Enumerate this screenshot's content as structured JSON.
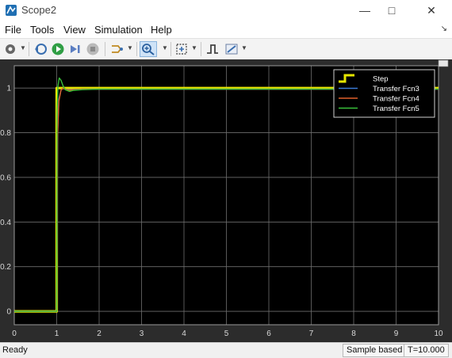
{
  "window": {
    "title": "Scope2"
  },
  "menu": [
    "File",
    "Tools",
    "View",
    "Simulation",
    "Help"
  ],
  "status": {
    "left": "Ready",
    "mode": "Sample based",
    "time": "T=10.000"
  },
  "colors": {
    "plot_bg": "#000000",
    "frame_bg": "#2c2c2c",
    "grid": "#6e6e6e",
    "axis_text": "#d9d9d9",
    "step": "#e6e600",
    "fcn3": "#3a7bd5",
    "fcn4": "#e0602a",
    "fcn5": "#39c13a"
  },
  "chart_data": {
    "type": "line",
    "title": "",
    "xlabel": "",
    "ylabel": "",
    "xlim": [
      0,
      10
    ],
    "ylim": [
      -0.06,
      1.1
    ],
    "xticks": [
      "0",
      "1",
      "2",
      "3",
      "4",
      "5",
      "6",
      "7",
      "8",
      "9",
      "10"
    ],
    "yticks": [
      {
        "v": 0,
        "label": "0"
      },
      {
        "v": 0.2,
        "label": "0.2"
      },
      {
        "v": 0.4,
        "label": "0.4"
      },
      {
        "v": 0.6,
        "label": "0.6"
      },
      {
        "v": 0.8,
        "label": "0.8"
      },
      {
        "v": 1,
        "label": "1"
      }
    ],
    "grid": true,
    "legend_position": "top-right",
    "series": [
      {
        "name": "Step",
        "color": "#e6e600",
        "x": [
          0,
          1,
          1,
          10
        ],
        "y": [
          0,
          0,
          1,
          1
        ]
      },
      {
        "name": "Transfer Fcn3",
        "color": "#3a7bd5",
        "x": [
          0,
          1,
          1.02,
          1.05,
          1.1,
          1.15,
          1.2,
          1.3,
          1.4,
          1.6,
          2,
          10
        ],
        "y": [
          0,
          0,
          0.8,
          0.95,
          0.99,
          1.0,
          0.995,
          0.992,
          0.994,
          0.995,
          0.995,
          0.995
        ]
      },
      {
        "name": "Transfer Fcn4",
        "color": "#e0602a",
        "x": [
          0,
          1,
          1.02,
          1.05,
          1.1,
          1.15,
          1.2,
          1.3,
          1.4,
          1.6,
          2,
          10
        ],
        "y": [
          0,
          0,
          0.78,
          0.94,
          0.99,
          1.0,
          0.995,
          0.99,
          0.993,
          0.995,
          0.995,
          0.995
        ]
      },
      {
        "name": "Transfer Fcn5",
        "color": "#39c13a",
        "x": [
          0,
          1,
          1.01,
          1.03,
          1.06,
          1.1,
          1.15,
          1.2,
          1.3,
          1.4,
          1.6,
          2,
          10
        ],
        "y": [
          0,
          0,
          0.9,
          1.01,
          1.045,
          1.035,
          1.01,
          0.993,
          0.985,
          0.99,
          0.993,
          0.995,
          0.995
        ]
      }
    ]
  }
}
